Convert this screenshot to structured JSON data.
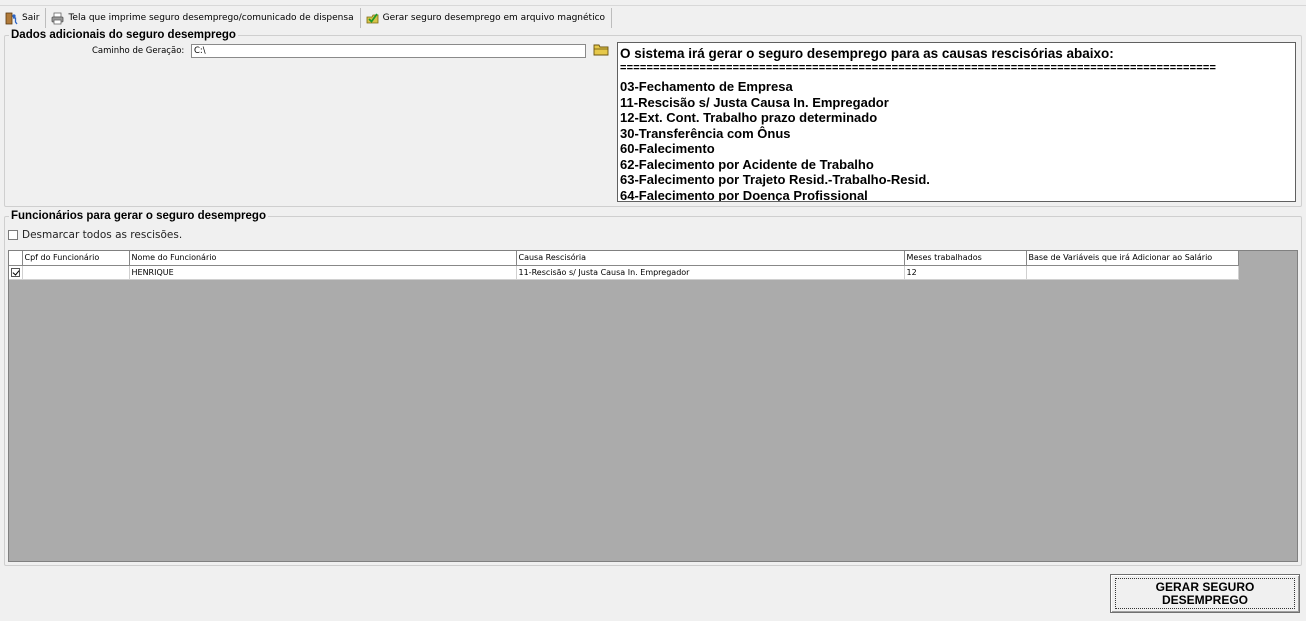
{
  "toolbar": {
    "exit_label": "Sair",
    "print_label": "Tela que imprime seguro desemprego/comunicado de dispensa",
    "generate_file_label": "Gerar seguro desemprego em arquivo magnético",
    "icons": [
      "exit-icon",
      "printer-icon",
      "generate-file-icon"
    ]
  },
  "additional": {
    "legend": "Dados adicionais do seguro desemprego",
    "path_label": "Caminho de Geração:",
    "path_value": "C:\\",
    "causes_title": "O sistema irá gerar o seguro desemprego para as causas rescisórias abaixo:",
    "causes_rule": "==========================================================================================",
    "causes": [
      "03-Fechamento de Empresa",
      "11-Rescisão s/ Justa Causa In. Empregador",
      "12-Ext. Cont. Trabalho prazo determinado",
      "30-Transferência com Ônus",
      "60-Falecimento",
      "62-Falecimento por Acidente de Trabalho",
      "63-Falecimento por Trajeto Resid.-Trabalho-Resid.",
      "64-Falecimento por Doença Profissional"
    ]
  },
  "employees": {
    "legend": "Funcionários para gerar o seguro desemprego",
    "uncheck_all_label": "Desmarcar todos as rescisões.",
    "uncheck_all_checked": false,
    "columns": [
      "Cpf do Funcionário",
      "Nome do Funcionário",
      "Causa Rescisória",
      "Meses trabalhados",
      "Base de Variáveis que irá Adicionar ao Salário"
    ],
    "rows": [
      {
        "checked": true,
        "cpf": "",
        "name": "HENRIQUE",
        "cause": "11-Rescisão s/ Justa Causa In. Empregador",
        "months": "12",
        "base": ""
      }
    ]
  },
  "action": {
    "line1": "GERAR SEGURO",
    "line2": "DESEMPREGO"
  }
}
